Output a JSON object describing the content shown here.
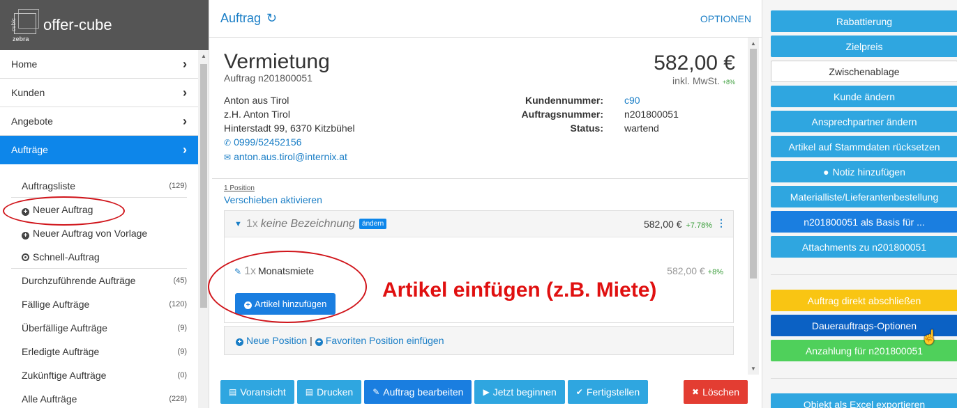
{
  "app": {
    "brand": "offer-cube",
    "logo_small_top": "cubic",
    "logo_small_bottom": "zebra"
  },
  "sidebar": {
    "items": [
      {
        "label": "Home"
      },
      {
        "label": "Kunden"
      },
      {
        "label": "Angebote"
      },
      {
        "label": "Aufträge",
        "active": true
      }
    ],
    "sub_items": [
      {
        "label": "Auftragsliste",
        "count": "(129)"
      },
      {
        "label": "Neuer Auftrag",
        "icon": "plus-circle-icon"
      },
      {
        "label": "Neuer Auftrag von Vorlage",
        "icon": "plus-circle-icon"
      },
      {
        "label": "Schnell-Auftrag",
        "icon": "dot-circle-icon"
      },
      {
        "label": "Durchzuführende Aufträge",
        "count": "(45)"
      },
      {
        "label": "Fällige Aufträge",
        "count": "(120)"
      },
      {
        "label": "Überfällige Aufträge",
        "count": "(9)"
      },
      {
        "label": "Erledigte Aufträge",
        "count": "(9)"
      },
      {
        "label": "Zukünftige Aufträge",
        "count": "(0)"
      },
      {
        "label": "Alle Aufträge",
        "count": "(228)"
      }
    ]
  },
  "main": {
    "title": "Auftrag",
    "options": "OPTIONEN",
    "order": {
      "type": "Vermietung",
      "number_line": "Auftrag n201800051",
      "price": "582,00 €",
      "price_note": "inkl. MwSt.",
      "price_pct": "+8%",
      "address": {
        "name": "Anton aus Tirol",
        "contact": "z.H. Anton Tirol",
        "street": "Hinterstadt 99, 6370 Kitzbühel",
        "phone": "0999/52452156",
        "email": "anton.aus.tirol@internix.at"
      },
      "details": [
        {
          "key": "Kundennummer:",
          "value": "c90"
        },
        {
          "key": "Auftragsnummer:",
          "value": "n201800051"
        },
        {
          "key": "Status:",
          "value": "wartend"
        }
      ]
    },
    "positions": {
      "count": "1 Position",
      "move": "Verschieben aktivieren",
      "group": {
        "qty": "1x",
        "name": "keine Bezeichnung",
        "badge": "ändern",
        "price": "582,00 €",
        "pct": "+7.78%"
      },
      "article": {
        "qty": "1x",
        "name": "Monatsmiete",
        "price": "582,00 €",
        "pct": "+8%"
      },
      "add_article": "Artikel hinzufügen",
      "new_position": "Neue Position",
      "separator": "|",
      "favorite_position": "Favoriten Position einfügen"
    },
    "annotation": "Artikel einfügen (z.B. Miete)",
    "footer": {
      "preview": "Voransicht",
      "print": "Drucken",
      "edit": "Auftrag bearbeiten",
      "start": "Jetzt beginnen",
      "finish": "Fertigstellen",
      "delete": "Löschen"
    }
  },
  "right": {
    "buttons": [
      {
        "label": "Rabattierung"
      },
      {
        "label": "Zielpreis"
      },
      {
        "label": "Zwischenablage"
      },
      {
        "label": "Kunde ändern"
      },
      {
        "label": "Ansprechpartner ändern"
      },
      {
        "label": "Artikel auf Stammdaten rücksetzen"
      },
      {
        "label": "Notiz hinzufügen"
      },
      {
        "label": "Materialliste/Lieferantenbestellung"
      },
      {
        "label": "n201800051 als Basis für ..."
      },
      {
        "label": "Attachments zu n201800051"
      },
      {
        "label": "Auftrag direkt abschließen"
      },
      {
        "label": "Dauerauftrags-Optionen"
      },
      {
        "label": "Anzahlung für n201800051"
      },
      {
        "label": "Objekt als Excel exportieren"
      }
    ]
  },
  "colors": {
    "primary": "#0d86ea",
    "link": "#1a7ec6",
    "button_light": "#2fa6e0",
    "annotation": "#e01010",
    "warning": "#f9c513",
    "success": "#4fd05b",
    "danger": "#e33d32"
  }
}
